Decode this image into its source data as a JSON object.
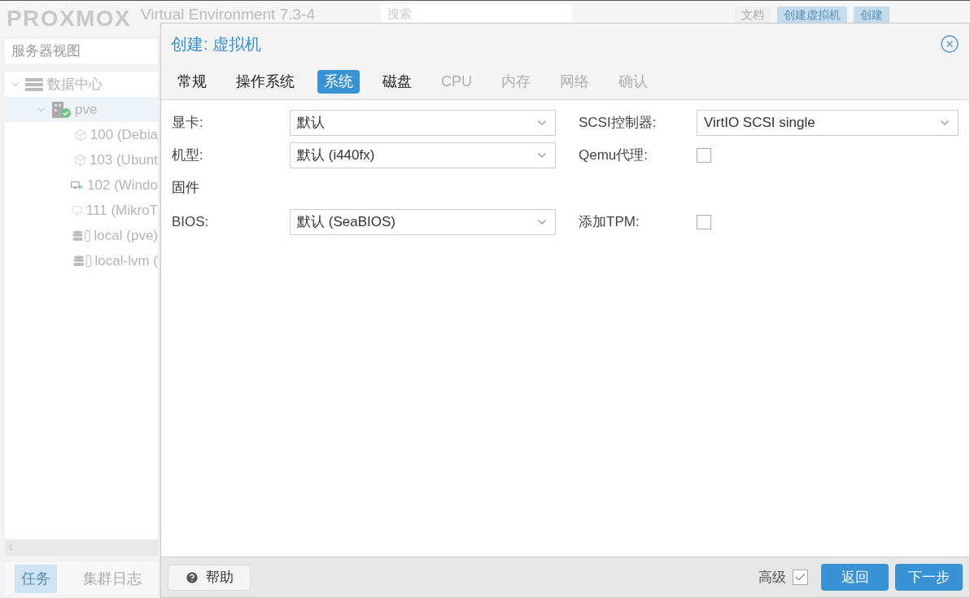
{
  "header": {
    "logo": "PROXMOX",
    "version": "Virtual Environment 7.3-4",
    "search": {
      "placeholder": "搜索"
    },
    "buttons": [
      "文档",
      "创建虚拟机",
      "创建"
    ]
  },
  "view_selector": {
    "value": "服务器视图"
  },
  "tree": [
    {
      "label": "数据中心",
      "kind": "datacenter",
      "expanded": true,
      "selected": false,
      "children": [
        {
          "label": "pve",
          "kind": "node",
          "expanded": true,
          "selected": true,
          "children": [
            {
              "label": "100 (Debia",
              "kind": "vm-stopped",
              "selected": false
            },
            {
              "label": "103 (Ubunt",
              "kind": "vm-stopped",
              "selected": false
            },
            {
              "label": "102 (Windo",
              "kind": "vm-running",
              "selected": false
            },
            {
              "label": "111 (MikroT",
              "kind": "vm-off",
              "selected": false
            },
            {
              "label": "local (pve)",
              "kind": "storage",
              "selected": false
            },
            {
              "label": "local-lvm (",
              "kind": "storage",
              "selected": false
            }
          ]
        }
      ]
    }
  ],
  "log_tabs": [
    {
      "label": "任务",
      "selected": true
    },
    {
      "label": "集群日志",
      "selected": false
    }
  ],
  "dialog": {
    "title": "创建: 虚拟机",
    "tabs": [
      {
        "label": "常规",
        "selected": false,
        "disabled": false
      },
      {
        "label": "操作系统",
        "selected": false,
        "disabled": false
      },
      {
        "label": "系统",
        "selected": true,
        "disabled": false
      },
      {
        "label": "磁盘",
        "selected": false,
        "disabled": false
      },
      {
        "label": "CPU",
        "selected": false,
        "disabled": true
      },
      {
        "label": "内存",
        "selected": false,
        "disabled": true
      },
      {
        "label": "网络",
        "selected": false,
        "disabled": true
      },
      {
        "label": "确认",
        "selected": false,
        "disabled": true
      }
    ],
    "rows": [
      {
        "left": {
          "kind": "select",
          "label": "显卡:",
          "value": "默认"
        },
        "right": {
          "kind": "select",
          "label": "SCSI控制器:",
          "value": "VirtIO SCSI single"
        }
      },
      {
        "left": {
          "kind": "select",
          "label": "机型:",
          "value": "默认 (i440fx)"
        },
        "right": {
          "kind": "checkbox",
          "label": "Qemu代理:",
          "checked": false
        }
      },
      {
        "left": {
          "kind": "section",
          "label": "固件"
        }
      },
      {
        "left": {
          "kind": "select",
          "label": "BIOS:",
          "value": "默认 (SeaBIOS)"
        },
        "right": {
          "kind": "checkbox",
          "label": "添加TPM:",
          "checked": false
        }
      }
    ],
    "help": "帮助",
    "advanced": {
      "label": "高级",
      "checked": true
    },
    "buttons": [
      "返回",
      "下一步"
    ]
  }
}
